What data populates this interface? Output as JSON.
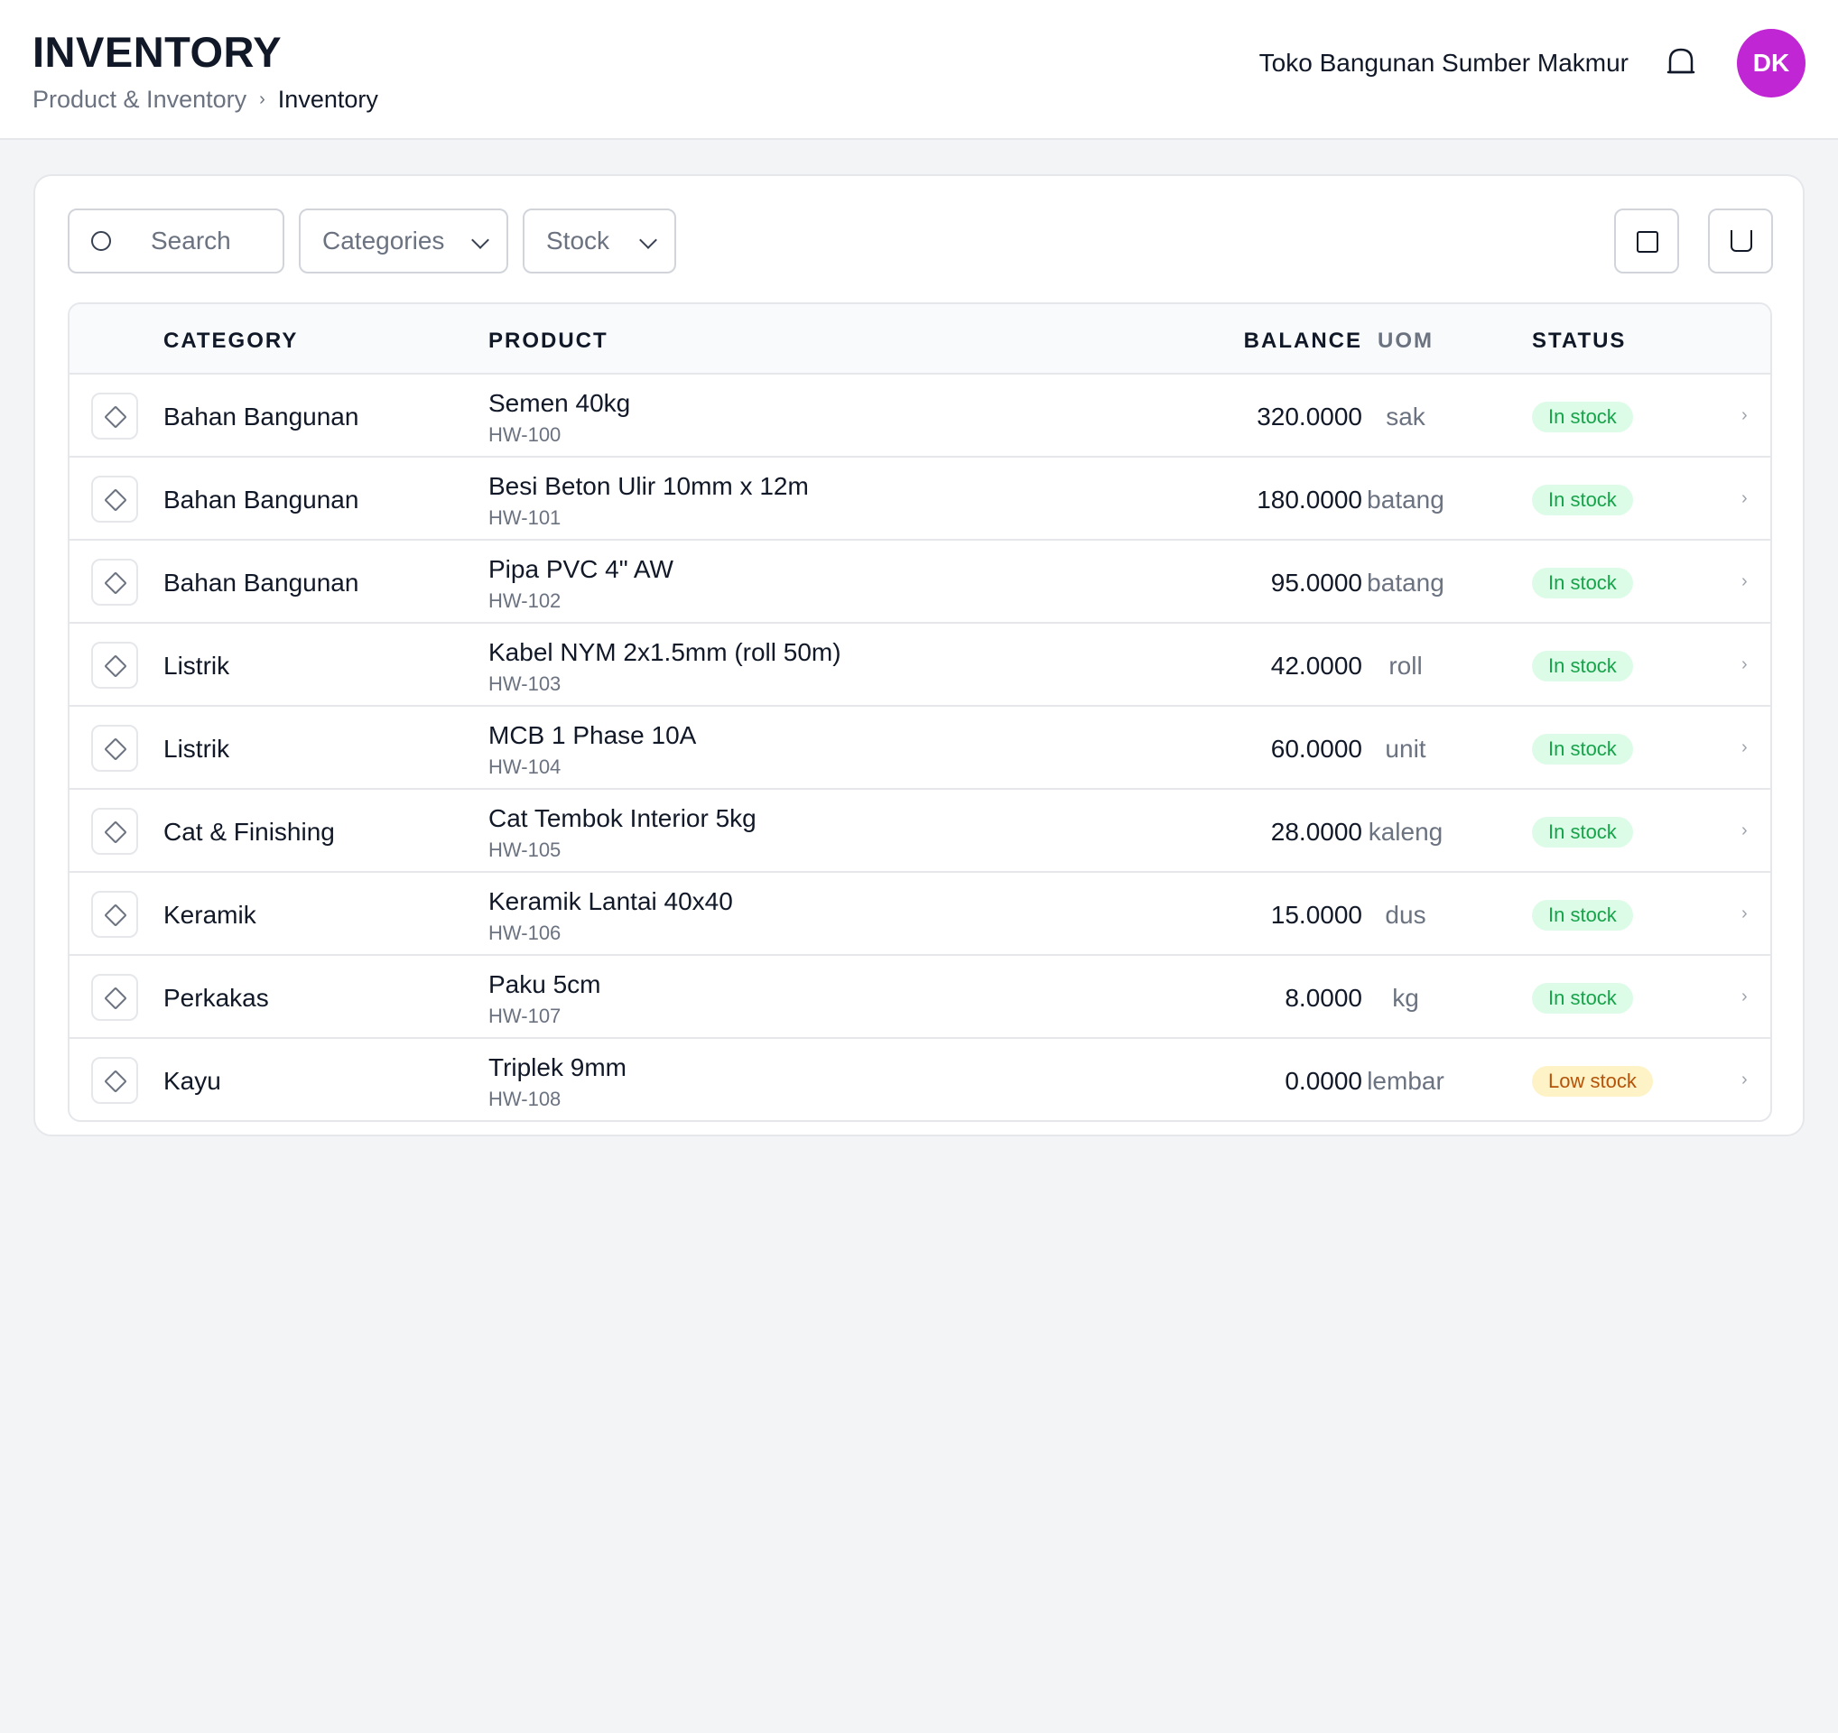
{
  "header": {
    "title": "INVENTORY",
    "breadcrumb": [
      "Product & Inventory",
      "Inventory"
    ],
    "breadcrumb_separator": "›",
    "store_name": "Toko Bangunan Sumber Makmur",
    "avatar_initials": "DK",
    "avatar_color": "#c026d3",
    "bell_icon": "bell-icon"
  },
  "toolbar": {
    "search_placeholder": "Search",
    "categories_label": "Categories",
    "stock_label": "Stock"
  },
  "table": {
    "columns": {
      "category": "CATEGORY",
      "product": "PRODUCT",
      "balance": "BALANCE",
      "uom": "UOM",
      "status": "STATUS"
    },
    "row_chevron": "›",
    "rows": [
      {
        "category": "Bahan Bangunan",
        "name": "Semen 40kg",
        "sku": "HW-100",
        "balance": "320.0000",
        "uom": "sak",
        "status": "In stock",
        "status_type": "in"
      },
      {
        "category": "Bahan Bangunan",
        "name": "Besi Beton Ulir 10mm x 12m",
        "sku": "HW-101",
        "balance": "180.0000",
        "uom": "batang",
        "status": "In stock",
        "status_type": "in"
      },
      {
        "category": "Bahan Bangunan",
        "name": "Pipa PVC 4\" AW",
        "sku": "HW-102",
        "balance": "95.0000",
        "uom": "batang",
        "status": "In stock",
        "status_type": "in"
      },
      {
        "category": "Listrik",
        "name": "Kabel NYM 2x1.5mm (roll 50m)",
        "sku": "HW-103",
        "balance": "42.0000",
        "uom": "roll",
        "status": "In stock",
        "status_type": "in"
      },
      {
        "category": "Listrik",
        "name": "MCB 1 Phase 10A",
        "sku": "HW-104",
        "balance": "60.0000",
        "uom": "unit",
        "status": "In stock",
        "status_type": "in"
      },
      {
        "category": "Cat & Finishing",
        "name": "Cat Tembok Interior 5kg",
        "sku": "HW-105",
        "balance": "28.0000",
        "uom": "kaleng",
        "status": "In stock",
        "status_type": "in"
      },
      {
        "category": "Keramik",
        "name": "Keramik Lantai 40x40",
        "sku": "HW-106",
        "balance": "15.0000",
        "uom": "dus",
        "status": "In stock",
        "status_type": "in"
      },
      {
        "category": "Perkakas",
        "name": "Paku 5cm",
        "sku": "HW-107",
        "balance": "8.0000",
        "uom": "kg",
        "status": "In stock",
        "status_type": "in"
      },
      {
        "category": "Kayu",
        "name": "Triplek 9mm",
        "sku": "HW-108",
        "balance": "0.0000",
        "uom": "lembar",
        "status": "Low stock",
        "status_type": "low"
      }
    ]
  }
}
